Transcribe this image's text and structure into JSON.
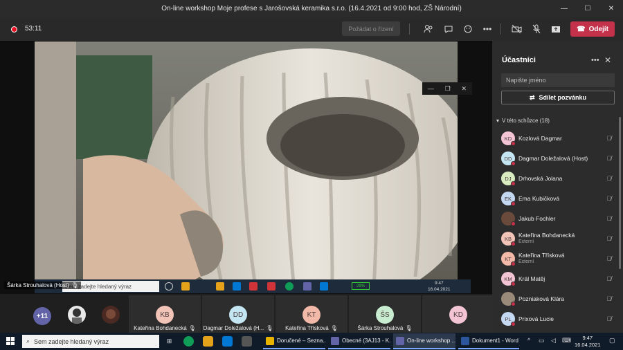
{
  "window": {
    "title": "On-line workshop Moje profese s Jarošovská keramika s.r.o. (16.4.2021 od 9:00 hod, ZŠ Národní)"
  },
  "callbar": {
    "timer": "53:11",
    "ask_control": "Požádat o řízení",
    "leave": "Odejít"
  },
  "shared_screen": {
    "presenter": "Šárka Strouhalová (Host)",
    "search_placeholder": "Sem zadejte hledaný výraz",
    "battery": "29%",
    "time": "9:47",
    "date": "16.04.2021"
  },
  "strip": {
    "more": "+11",
    "tiles": [
      {
        "initials": "KB",
        "name": "Kateřina Bohdanecká",
        "color": "#f2c4b8"
      },
      {
        "initials": "DD",
        "name": "Dagmar Doležalová (H...",
        "color": "#c4e6f2"
      },
      {
        "initials": "KT",
        "name": "Kateřina Třísková",
        "color": "#f2b8a8"
      },
      {
        "initials": "ŠS",
        "name": "Šárka Strouhalová",
        "color": "#c8ecd0"
      },
      {
        "initials": "KD",
        "name": "",
        "color": "#f2c4d4"
      }
    ]
  },
  "panel": {
    "title": "Účastníci",
    "search_placeholder": "Napište jméno",
    "share": "Sdílet pozvánku",
    "section": "V této schůzce (18)",
    "participants": [
      {
        "initials": "KD",
        "name": "Kozlová Dagmar",
        "sub": "",
        "color": "#f2c4d4"
      },
      {
        "initials": "DD",
        "name": "Dagmar Doležalová (Host)",
        "sub": "",
        "color": "#c4e6f2"
      },
      {
        "initials": "DJ",
        "name": "Drhovská Jolana",
        "sub": "",
        "color": "#d8ecc0"
      },
      {
        "initials": "EK",
        "name": "Ema Kubičková",
        "sub": "",
        "color": "#c4d8f2"
      },
      {
        "initials": "",
        "name": "Jakub Fochler",
        "sub": "",
        "color": "#6a4a3a"
      },
      {
        "initials": "KB",
        "name": "Kateřina Bohdanecká",
        "sub": "Externí",
        "color": "#f2c4b8"
      },
      {
        "initials": "KT",
        "name": "Kateřina Třísková",
        "sub": "Externí",
        "color": "#f2b8a8"
      },
      {
        "initials": "KM",
        "name": "Král Matěj",
        "sub": "",
        "color": "#f2c4d4"
      },
      {
        "initials": "",
        "name": "Pozniaková Klára",
        "sub": "",
        "color": "#9a8a7a"
      },
      {
        "initials": "PL",
        "name": "Prixová Lucie",
        "sub": "",
        "color": "#c4d8f2"
      }
    ]
  },
  "taskbar": {
    "search_placeholder": "Sem zadejte hledaný výraz",
    "apps": [
      {
        "label": "Doručené – Sezna...",
        "color": "#e8b400"
      },
      {
        "label": "Obecné (3AJ13 - K...",
        "color": "#6264a7"
      },
      {
        "label": "On-line workshop ...",
        "color": "#6264a7"
      },
      {
        "label": "Dokument1 - Word",
        "color": "#2b579a"
      }
    ],
    "time": "9:47",
    "date": "16.04.2021"
  }
}
